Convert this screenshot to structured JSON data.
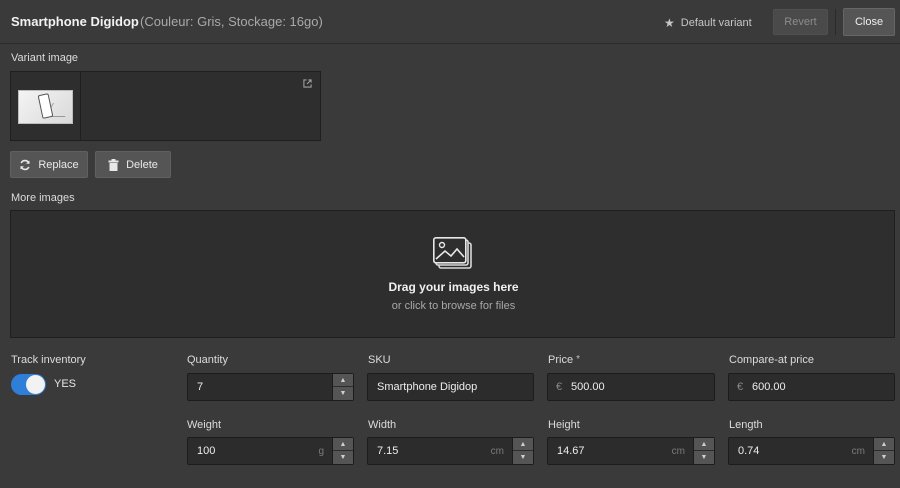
{
  "header": {
    "title": "Smartphone Digidop",
    "subtitle": "(Couleur: Gris, Stockage: 16go)",
    "default_variant_label": "Default variant",
    "revert_label": "Revert",
    "close_label": "Close"
  },
  "variant_image": {
    "label": "Variant image",
    "replace_label": "Replace",
    "delete_label": "Delete"
  },
  "more_images": {
    "label": "More images",
    "drop_title": "Drag your images here",
    "drop_subtitle": "or click to browse for files"
  },
  "inventory": {
    "track_label": "Track inventory",
    "toggle_state": "YES",
    "toggle_on": true
  },
  "fields": {
    "quantity": {
      "label": "Quantity",
      "value": "7"
    },
    "sku": {
      "label": "SKU",
      "value": "Smartphone Digidop"
    },
    "price": {
      "label": "Price",
      "required_mark": "*",
      "currency": "€",
      "value": "500.00"
    },
    "compare_at_price": {
      "label": "Compare-at price",
      "currency": "€",
      "value": "600.00"
    },
    "weight": {
      "label": "Weight",
      "value": "100",
      "unit": "g"
    },
    "width": {
      "label": "Width",
      "value": "7.15",
      "unit": "cm"
    },
    "height": {
      "label": "Height",
      "value": "14.67",
      "unit": "cm"
    },
    "length": {
      "label": "Length",
      "value": "0.74",
      "unit": "cm"
    }
  },
  "icons": {
    "star": "star-icon",
    "external": "external-link-icon",
    "replace": "refresh-icon",
    "delete": "trash-icon",
    "images": "images-icon",
    "up": "chevron-up-icon",
    "down": "chevron-down-icon"
  },
  "colors": {
    "background": "#3a3a3a",
    "panel": "#2e2e2e",
    "accent": "#2f7fd8"
  }
}
